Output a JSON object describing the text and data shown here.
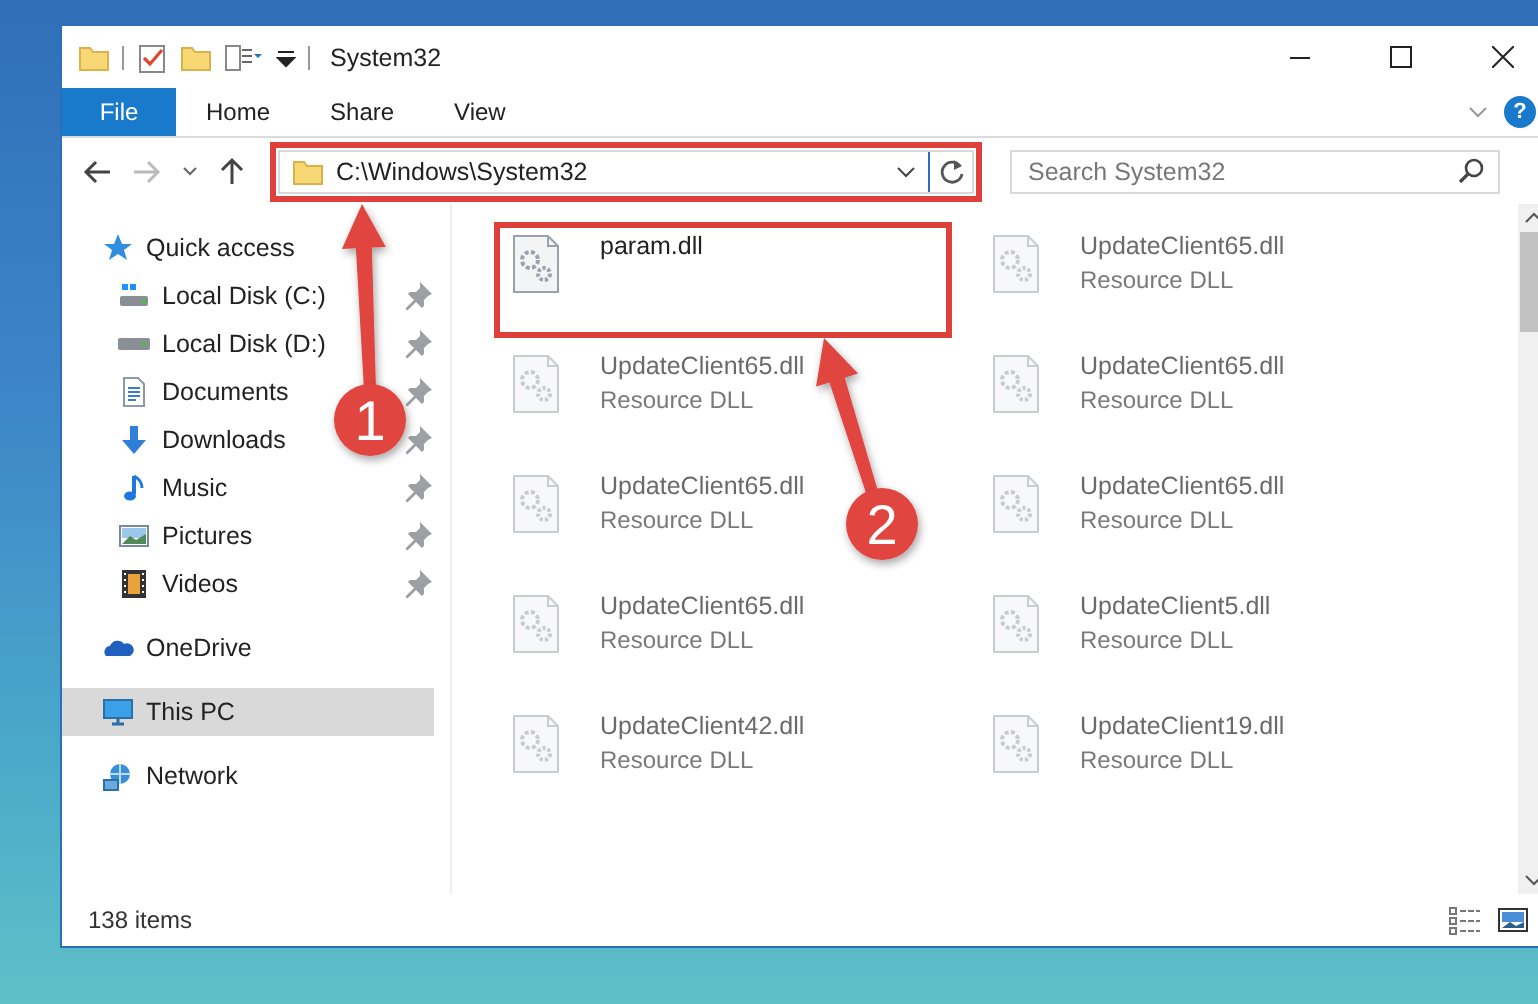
{
  "window": {
    "title": "System32"
  },
  "ribbon": {
    "tabs": [
      {
        "label": "File",
        "selected": true
      },
      {
        "label": "Home",
        "selected": false
      },
      {
        "label": "Share",
        "selected": false
      },
      {
        "label": "View",
        "selected": false
      }
    ],
    "help": "?"
  },
  "address_bar": {
    "path": "C:\\Windows\\System32",
    "highlighted": true
  },
  "search": {
    "placeholder": "Search System32"
  },
  "sidebar": {
    "items": [
      {
        "label": "Quick access",
        "kind": "header",
        "pinned": false,
        "selected": false
      },
      {
        "label": "Local Disk (C:)",
        "kind": "item",
        "pinned": true,
        "selected": false
      },
      {
        "label": "Local Disk (D:)",
        "kind": "item",
        "pinned": true,
        "selected": false
      },
      {
        "label": "Documents",
        "kind": "item",
        "pinned": true,
        "selected": false
      },
      {
        "label": "Downloads",
        "kind": "item",
        "pinned": true,
        "selected": false
      },
      {
        "label": "Music",
        "kind": "item",
        "pinned": true,
        "selected": false
      },
      {
        "label": "Pictures",
        "kind": "item",
        "pinned": true,
        "selected": false
      },
      {
        "label": "Videos",
        "kind": "item",
        "pinned": true,
        "selected": false
      },
      {
        "label": "OneDrive",
        "kind": "header",
        "pinned": false,
        "selected": false
      },
      {
        "label": "This PC",
        "kind": "header",
        "pinned": false,
        "selected": true
      },
      {
        "label": "Network",
        "kind": "header",
        "pinned": false,
        "selected": false
      }
    ]
  },
  "files": [
    {
      "name": "param.dll",
      "highlighted": true,
      "blurred": false
    },
    {
      "name": "UpdateClient65.dll",
      "type": "Resource DLL",
      "highlighted": false,
      "blurred": true
    },
    {
      "name": "UpdateClient65.dll",
      "type": "Resource DLL",
      "highlighted": false,
      "blurred": true
    },
    {
      "name": "UpdateClient65.dll",
      "type": "Resource DLL",
      "highlighted": false,
      "blurred": true
    },
    {
      "name": "UpdateClient65.dll",
      "type": "Resource DLL",
      "highlighted": false,
      "blurred": true
    },
    {
      "name": "UpdateClient65.dll",
      "type": "Resource DLL",
      "highlighted": false,
      "blurred": true
    },
    {
      "name": "UpdateClient65.dll",
      "type": "Resource DLL",
      "highlighted": false,
      "blurred": true
    },
    {
      "name": "UpdateClient5.dll",
      "type": "Resource DLL",
      "highlighted": false,
      "blurred": true
    },
    {
      "name": "UpdateClient42.dll",
      "type": "Resource DLL",
      "highlighted": false,
      "blurred": true
    },
    {
      "name": "UpdateClient19.dll",
      "type": "Resource DLL",
      "highlighted": false,
      "blurred": true
    }
  ],
  "status_bar": {
    "item_count": "138 items"
  },
  "callouts": [
    {
      "label": "1"
    },
    {
      "label": "2"
    }
  ]
}
